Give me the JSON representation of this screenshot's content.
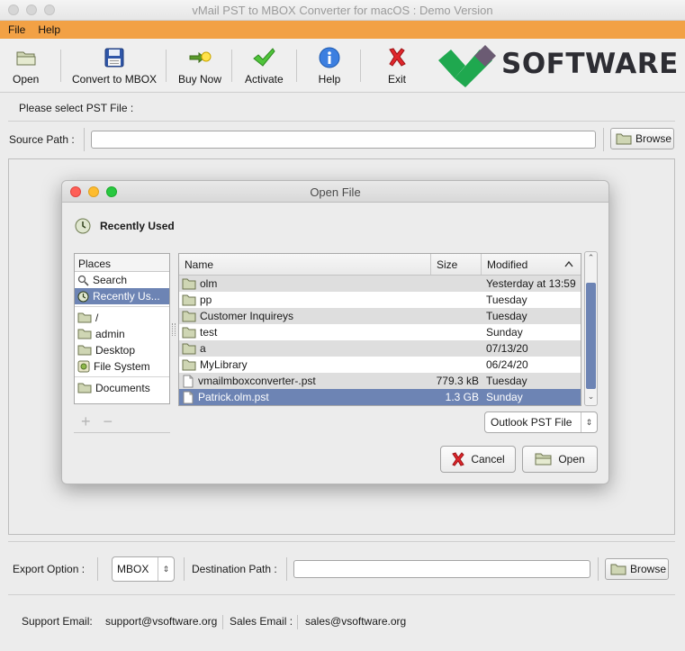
{
  "window": {
    "title": "vMail PST to MBOX Converter for macOS : Demo Version"
  },
  "menu": {
    "file": "File",
    "help": "Help"
  },
  "toolbar": {
    "open": "Open",
    "convert": "Convert to MBOX",
    "buy": "Buy Now",
    "activate": "Activate",
    "help": "Help",
    "exit": "Exit"
  },
  "logo": {
    "text": "SOFTWARE"
  },
  "source": {
    "prompt": "Please select PST File :",
    "label": "Source Path :",
    "value": "",
    "browse": "Browse"
  },
  "dialog": {
    "title": "Open File",
    "location": "Recently Used",
    "places_header": "Places",
    "places": [
      {
        "label": "Search",
        "icon": "search-icon"
      },
      {
        "label": "Recently Us...",
        "icon": "recent-icon",
        "selected": true
      },
      {
        "label": "/",
        "icon": "folder-icon"
      },
      {
        "label": "admin",
        "icon": "folder-icon"
      },
      {
        "label": "Desktop",
        "icon": "folder-icon"
      },
      {
        "label": "File System",
        "icon": "drive-icon"
      },
      {
        "label": "Documents",
        "icon": "folder-icon"
      }
    ],
    "add": "+",
    "remove": "−",
    "columns": {
      "name": "Name",
      "size": "Size",
      "modified": "Modified"
    },
    "files": [
      {
        "name": "olm",
        "type": "folder",
        "size": "",
        "modified": "Yesterday at 13:59"
      },
      {
        "name": "pp",
        "type": "folder",
        "size": "",
        "modified": "Tuesday"
      },
      {
        "name": "Customer Inquireys",
        "type": "folder",
        "size": "",
        "modified": "Tuesday"
      },
      {
        "name": "test",
        "type": "folder",
        "size": "",
        "modified": "Sunday"
      },
      {
        "name": "a",
        "type": "folder",
        "size": "",
        "modified": "07/13/20"
      },
      {
        "name": "MyLibrary",
        "type": "folder",
        "size": "",
        "modified": "06/24/20"
      },
      {
        "name": "vmailmboxconverter-.pst",
        "type": "file",
        "size": "779.3 kB",
        "modified": "Tuesday"
      },
      {
        "name": "Patrick.olm.pst",
        "type": "file",
        "size": "1.3 GB",
        "modified": "Sunday",
        "selected": true
      }
    ],
    "filter": "Outlook PST File",
    "cancel": "Cancel",
    "open": "Open"
  },
  "export": {
    "label": "Export Option :",
    "format": "MBOX",
    "dest_label": "Destination Path :",
    "dest_value": "",
    "browse": "Browse"
  },
  "footer": {
    "support_label": "Support Email:",
    "support_email": "support@vsoftware.org",
    "sales_label": "Sales Email :",
    "sales_email": "sales@vsoftware.org"
  },
  "colors": {
    "menu_bar": "#f2a145",
    "selection": "#6d84b4",
    "logo_green": "#1fa84f",
    "logo_purple": "#6b5b73"
  }
}
